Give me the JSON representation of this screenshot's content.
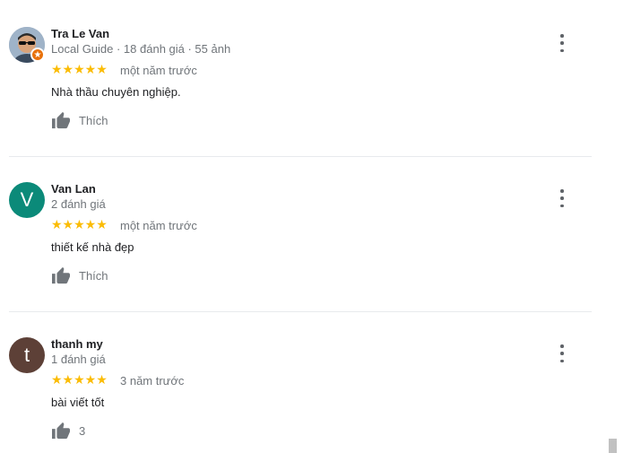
{
  "reviews": [
    {
      "name": "Tra Le Van",
      "meta": "Local Guide · 18 đánh giá · 55 ảnh",
      "avatar": {
        "type": "photo",
        "badge_icon": "star-badge-icon"
      },
      "stars": "★★★★★",
      "rating": 5,
      "time": "một năm trước",
      "text": "Nhà thầu chuyên nghiệp.",
      "like_label": "Thích"
    },
    {
      "name": "Van Lan",
      "meta": "2 đánh giá",
      "avatar": {
        "type": "letter",
        "letter": "V",
        "color": "#0b8a79"
      },
      "stars": "★★★★★",
      "rating": 5,
      "time": "một năm trước",
      "text": "thiết kế nhà đẹp",
      "like_label": "Thích"
    },
    {
      "name": "thanh my",
      "meta": "1 đánh giá",
      "avatar": {
        "type": "letter",
        "letter": "t",
        "color": "#5d4037"
      },
      "stars": "★★★★★",
      "rating": 5,
      "time": "3 năm trước",
      "text": "bài viết tốt",
      "like_label": "3"
    }
  ],
  "colors": {
    "star": "#fbbc04",
    "secondary_text": "#70757a",
    "divider": "#e8eaed"
  }
}
